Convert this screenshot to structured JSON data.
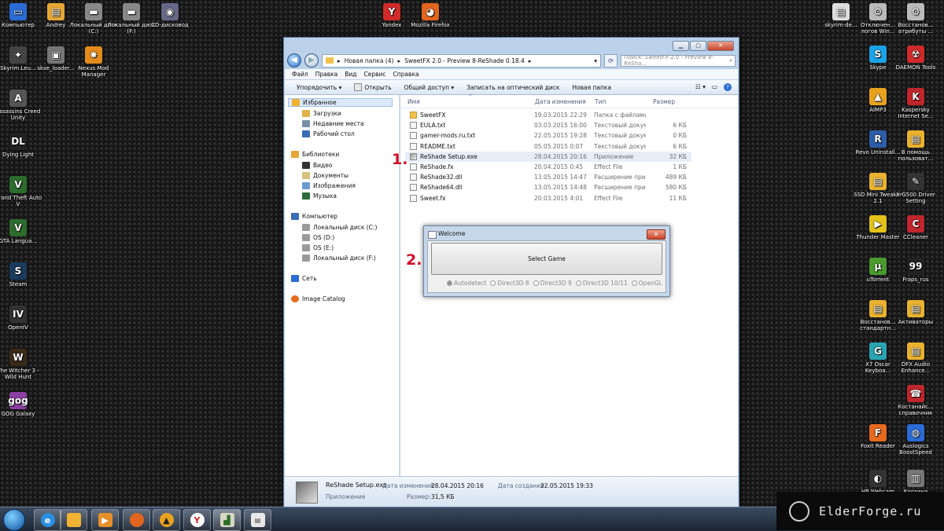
{
  "desktop": {
    "icons_left_col1": [
      {
        "label": "Компьютер",
        "color": "#2a6bd6",
        "glyph": "▭"
      },
      {
        "label": "Skyrim.Leu...",
        "color": "#444444",
        "glyph": "✦"
      },
      {
        "label": "Assassins Creed Unity",
        "color": "#555555",
        "glyph": "A"
      },
      {
        "label": "Dying Light",
        "color": "#222222",
        "glyph": "DL"
      },
      {
        "label": "Grand Theft Auto V",
        "color": "#2e6b2e",
        "glyph": "V"
      },
      {
        "label": "GTA Langua...",
        "color": "#2e6b2e",
        "glyph": "V"
      },
      {
        "label": "Steam",
        "color": "#1b3a5c",
        "glyph": "S"
      },
      {
        "label": "OpenIV",
        "color": "#333333",
        "glyph": "IV"
      },
      {
        "label": "The Witcher 3 - Wild Hunt",
        "color": "#3a2a1a",
        "glyph": "W"
      },
      {
        "label": "GOG Galaxy",
        "color": "#8b3fa3",
        "glyph": "gog"
      }
    ],
    "icons_left_col2": [
      {
        "label": "Andrey",
        "color": "#e6a735",
        "glyph": "▤"
      },
      {
        "label": "skse_loader...",
        "color": "#777777",
        "glyph": "▣"
      }
    ],
    "icons_left_col3": [
      {
        "label": "Локальный диск (C:)",
        "color": "#888888",
        "glyph": "▬"
      },
      {
        "label": "Nexus Mod Manager",
        "color": "#e38b1c",
        "glyph": "✸"
      }
    ],
    "icons_top_row": [
      {
        "label": "Локальный диск (F:)",
        "color": "#888888",
        "glyph": "▬"
      },
      {
        "label": "CD-дисковод",
        "color": "#666688",
        "glyph": "◉"
      },
      {
        "label": "Yandex",
        "color": "#d22a2a",
        "glyph": "Y"
      },
      {
        "label": "Mozilla Firefox",
        "color": "#e1651e",
        "glyph": "◕"
      }
    ],
    "icons_right_col1": [
      {
        "label": "skyrim-de...",
        "color": "#dddddd",
        "glyph": "▤"
      },
      {
        "label": "Skype",
        "color": "#1aa3e6",
        "glyph": "S"
      },
      {
        "label": "AIMP3",
        "color": "#e8a21e",
        "glyph": "▲"
      },
      {
        "label": "Revo Uninstall...",
        "color": "#2d5da8",
        "glyph": "R"
      },
      {
        "label": "SSD Mini Tweaker 2.1",
        "color": "#e9b22f",
        "glyph": "▤"
      },
      {
        "label": "Thunder Master",
        "color": "#e3c31a",
        "glyph": "▶"
      },
      {
        "label": "uTorrent",
        "color": "#4a9b2e",
        "glyph": "µ"
      },
      {
        "label": "Восстанов... стандартн...",
        "color": "#e9b22f",
        "glyph": "▤"
      },
      {
        "label": "X7 Oscar Keyboa...",
        "color": "#2aa4b0",
        "glyph": "G"
      },
      {
        "label": "Foxit Reader",
        "color": "#e76a1f",
        "glyph": "F"
      },
      {
        "label": "HP Webcam",
        "color": "#333333",
        "glyph": "◐"
      }
    ],
    "icons_right_col2": [
      {
        "label": "Отключен... логов Win...",
        "color": "#bbbbbb",
        "glyph": "⚙"
      },
      {
        "label": "Восстанов... атрибуты ...",
        "color": "#bbbbbb",
        "glyph": "⚙"
      },
      {
        "label": "DAEMON Tools",
        "color": "#d02a2a",
        "glyph": "☢"
      },
      {
        "label": "Kaspersky Internet Se...",
        "color": "#c0262d",
        "glyph": "K"
      },
      {
        "label": "В помощь пользоват...",
        "color": "#e9b22f",
        "glyph": "▤"
      },
      {
        "label": "X-G500 Driver Setting",
        "color": "#333333",
        "glyph": "✎"
      },
      {
        "label": "CCleaner",
        "color": "#c0262d",
        "glyph": "C"
      },
      {
        "label": "Fraps_rus",
        "color": "#222222",
        "glyph": "99"
      },
      {
        "label": "Активаторы",
        "color": "#e9b22f",
        "glyph": "▤"
      },
      {
        "label": "DFX Audio Enhance...",
        "color": "#e9b22f",
        "glyph": "▤"
      },
      {
        "label": "Костанайс... справочник",
        "color": "#c0262d",
        "glyph": "☎"
      },
      {
        "label": "Auslogics BoostSpeed",
        "color": "#2a6bd6",
        "glyph": "◍"
      },
      {
        "label": "Корзина",
        "color": "#777777",
        "glyph": "▥"
      }
    ]
  },
  "explorer": {
    "breadcrumb": [
      "Новая папка (4)",
      "SweetFX 2.0 - Preview 8-ReShade 0.18.4"
    ],
    "search_placeholder": "Поиск: SweetFX 2.0 - Preview 8-ReSha...",
    "menu": [
      "Файл",
      "Правка",
      "Вид",
      "Сервис",
      "Справка"
    ],
    "toolbar": {
      "organize": "Упорядочить ▾",
      "open": "Открыть",
      "share": "Общий доступ ▾",
      "burn": "Записать на оптический диск",
      "new_folder": "Новая папка"
    },
    "nav": {
      "favorites": "Избранное",
      "favorites_items": [
        "Загрузки",
        "Недавние места",
        "Рабочий стол"
      ],
      "libraries": "Библиотеки",
      "libraries_items": [
        "Видео",
        "Документы",
        "Изображения",
        "Музыка"
      ],
      "computer": "Компьютер",
      "computer_items": [
        "Локальный диск (C:)",
        "OS (D:)",
        "OS (E:)",
        "Локальный диск (F:)"
      ],
      "network": "Сеть",
      "image_catalog": "Image Catalog"
    },
    "columns": {
      "name": "Имя",
      "date": "Дата изменения",
      "type": "Тип",
      "size": "Размер"
    },
    "files": [
      {
        "name": "SweetFX",
        "date": "19.03.2015 22:29",
        "type": "Папка с файлами",
        "size": "",
        "kind": "folder"
      },
      {
        "name": "EULA.txt",
        "date": "03.03.2015 16:00",
        "type": "Текстовый докум...",
        "size": "6 КБ",
        "kind": "txt"
      },
      {
        "name": "gamer-mods.ru.txt",
        "date": "22.05.2015 19:28",
        "type": "Текстовый докум...",
        "size": "0 КБ",
        "kind": "txt"
      },
      {
        "name": "README.txt",
        "date": "05.05.2015 0:07",
        "type": "Текстовый докум...",
        "size": "6 КБ",
        "kind": "txt"
      },
      {
        "name": "ReShade Setup.exe",
        "date": "28.04.2015 20:16",
        "type": "Приложение",
        "size": "32 КБ",
        "kind": "exe"
      },
      {
        "name": "ReShade.fx",
        "date": "20.04.2015 0:45",
        "type": "Effect File",
        "size": "1 КБ",
        "kind": "fx"
      },
      {
        "name": "ReShade32.dll",
        "date": "13.05.2015 14:47",
        "type": "Расширение при...",
        "size": "489 КБ",
        "kind": "dll"
      },
      {
        "name": "ReShade64.dll",
        "date": "13.05.2015 14:48",
        "type": "Расширение при...",
        "size": "580 КБ",
        "kind": "dll"
      },
      {
        "name": "Sweet.fx",
        "date": "20.03.2015 4:01",
        "type": "Effect File",
        "size": "11 КБ",
        "kind": "fx"
      }
    ],
    "details": {
      "name": "ReShade Setup.exe",
      "kind": "Приложение",
      "modified_label": "Дата изменения:",
      "modified": "28.04.2015 20:16",
      "created_label": "Дата создания:",
      "created": "22.05.2015 19:33",
      "size_label": "Размер:",
      "size": "31,5 КБ"
    }
  },
  "welcome": {
    "title": "Welcome",
    "select_game": "Select Game",
    "options": [
      "Autodetect",
      "Direct3D 8",
      "Direct3D 9",
      "Direct3D 10/11",
      "OpenGL"
    ],
    "selected": "Autodetect"
  },
  "annotations": [
    "1.",
    "2."
  ],
  "brand": "ElderForge.ru",
  "colors": {
    "annotation": "#d0102a",
    "window_frame": "#bcd2ea",
    "selected_row": "#e7eef7"
  }
}
